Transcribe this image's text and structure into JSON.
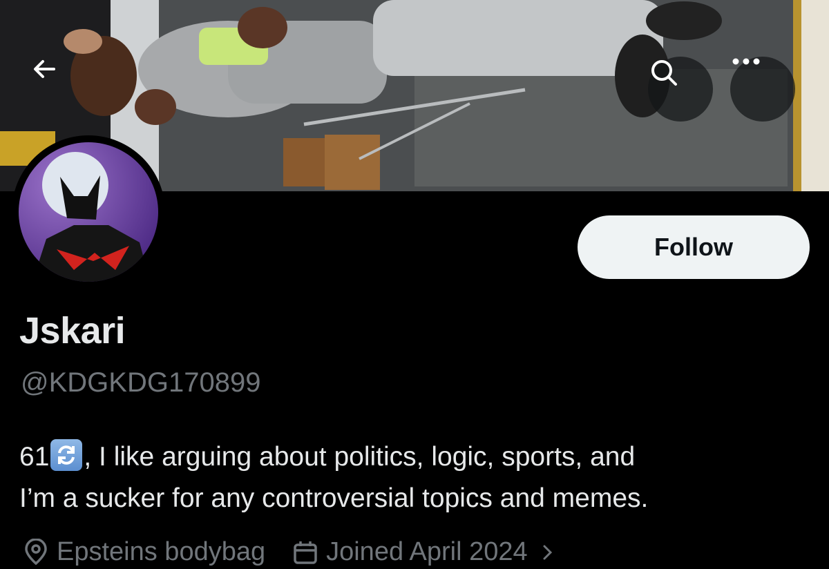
{
  "profile": {
    "display_name": "Jskari",
    "handle": "@KDGKDG170899",
    "bio_count": "61",
    "bio_emoji_icon": "repeat-arrows-emoji",
    "bio_text_line1": ", I like arguing about politics, logic, sports, and",
    "bio_text_line2": "I’m a sucker for any controversial topics and memes.",
    "location": "Epsteins bodybag",
    "joined": "Joined April 2024"
  },
  "actions": {
    "follow_label": "Follow"
  },
  "icons": {
    "back": "back-arrow-icon",
    "search": "search-icon",
    "more": "more-icon",
    "location": "location-pin-icon",
    "calendar": "calendar-icon",
    "chevron": "chevron-right-icon"
  },
  "colors": {
    "background": "#000000",
    "primary_text": "#e7e9ea",
    "secondary_text": "#71767b",
    "follow_button_bg": "#eff3f4",
    "follow_button_text": "#0f1419"
  }
}
